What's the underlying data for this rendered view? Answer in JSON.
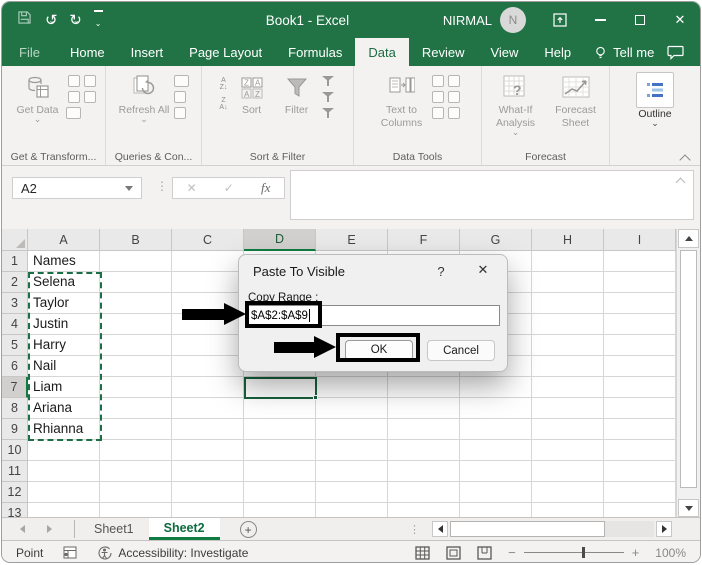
{
  "colors": {
    "titlebar_green": "#217346",
    "accent_green": "#107C41",
    "active_tab_text": "#1e6b43",
    "annotation_black": "#000000"
  },
  "titlebar": {
    "title": "Book1 - Excel",
    "user": "NIRMAL",
    "avatar_initial": "N"
  },
  "ribbon_tabs": {
    "file": "File",
    "home": "Home",
    "insert": "Insert",
    "page_layout": "Page Layout",
    "formulas": "Formulas",
    "data": "Data",
    "review": "Review",
    "view": "View",
    "help": "Help",
    "tell_me": "Tell me"
  },
  "ribbon": {
    "get_data": "Get Data",
    "group_get_transform": "Get & Transform...",
    "refresh_all": "Refresh All",
    "group_queries": "Queries & Con...",
    "sort": "Sort",
    "filter": "Filter",
    "group_sort_filter": "Sort & Filter",
    "text_to_columns": "Text to Columns",
    "group_data_tools": "Data Tools",
    "what_if": "What-If Analysis",
    "forecast_sheet": "Forecast Sheet",
    "group_forecast": "Forecast",
    "outline": "Outline"
  },
  "formula_bar": {
    "name_box": "A2",
    "fx": "fx"
  },
  "grid": {
    "column_headers": [
      "A",
      "B",
      "C",
      "D",
      "E",
      "F",
      "G",
      "H",
      "I"
    ],
    "row_headers": [
      "1",
      "2",
      "3",
      "4",
      "5",
      "6",
      "7",
      "8",
      "9",
      "10",
      "11",
      "12",
      "13"
    ],
    "column_a": [
      "Names",
      "Selena",
      "Taylor",
      "Justin",
      "Harry",
      "Nail",
      "Liam",
      "Ariana",
      "Rhianna"
    ],
    "active_column": "D",
    "active_row": "7"
  },
  "dialog": {
    "title": "Paste To Visible",
    "help": "?",
    "copy_range_label": "Copy Range :",
    "copy_range_value": "$A$2:$A$9",
    "ok": "OK",
    "cancel": "Cancel"
  },
  "sheet_bar": {
    "sheet1": "Sheet1",
    "sheet2": "Sheet2"
  },
  "status_bar": {
    "mode": "Point",
    "accessibility": "Accessibility: Investigate",
    "zoom_level": "100%"
  }
}
